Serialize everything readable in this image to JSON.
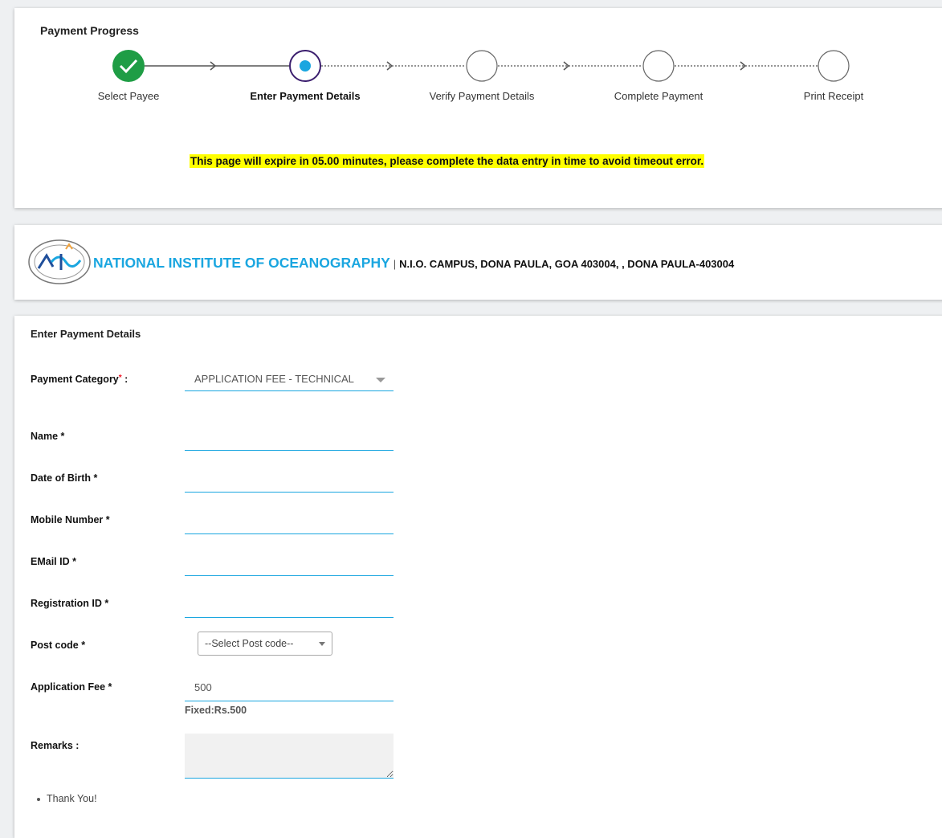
{
  "progress": {
    "title": "Payment Progress",
    "steps": [
      {
        "label": "Select Payee",
        "status": "completed"
      },
      {
        "label": "Enter Payment Details",
        "status": "current"
      },
      {
        "label": "Verify Payment Details",
        "status": "pending"
      },
      {
        "label": "Complete Payment",
        "status": "pending"
      },
      {
        "label": "Print Receipt",
        "status": "pending"
      }
    ],
    "expiry_notice": "This page will expire in 05.00 minutes, please complete the data entry in time to avoid timeout error."
  },
  "institute": {
    "name": "NATIONAL INSTITUTE OF OCEANOGRAPHY",
    "separator": "|",
    "address": "N.I.O. CAMPUS, DONA PAULA, GOA 403004, , DONA PAULA-403004",
    "logo_icon": "nio-logo"
  },
  "form": {
    "title": "Enter Payment Details",
    "payment_category": {
      "label": "Payment Category",
      "required_mark": "*",
      "suffix": ":",
      "value": "APPLICATION FEE - TECHNICAL"
    },
    "name": {
      "label": "Name *",
      "value": ""
    },
    "dob": {
      "label": "Date of Birth *",
      "value": ""
    },
    "mobile": {
      "label": "Mobile Number *",
      "value": ""
    },
    "email": {
      "label": "EMail ID *",
      "value": ""
    },
    "registration": {
      "label": "Registration ID *",
      "value": ""
    },
    "post_code": {
      "label": "Post code *",
      "selected": "--Select Post code--"
    },
    "application_fee": {
      "label": "Application Fee *",
      "value": "500",
      "note": "Fixed:Rs.500"
    },
    "remarks": {
      "label": "Remarks :",
      "value": ""
    },
    "thank_you": "Thank You!"
  },
  "colors": {
    "accent": "#1aa6e0",
    "completed": "#1f9d45",
    "current_ring": "#3b1e6e",
    "highlight": "#ffff00"
  }
}
